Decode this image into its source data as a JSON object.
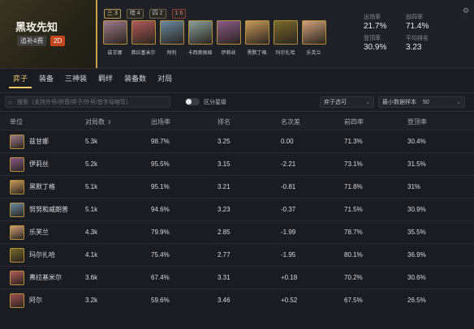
{
  "hero": {
    "title": "黑玫先知",
    "tier_tag": "追补4费",
    "cost_tag": "2D"
  },
  "traits": [
    {
      "label": "三 3",
      "style": "gold"
    },
    {
      "label": "暗 4",
      "style": ""
    },
    {
      "label": "四 2",
      "style": ""
    },
    {
      "label": "1 6",
      "style": "red"
    }
  ],
  "champions": [
    {
      "name": "兹甘娜",
      "color": "#9e7a8a"
    },
    {
      "name": "弗拉基米尔",
      "color": "#b05a58"
    },
    {
      "name": "阿利",
      "color": "#6a8aa0"
    },
    {
      "name": "卡西奥佩娅",
      "color": "#8aa09a"
    },
    {
      "name": "伊莉丝",
      "color": "#8a5a86"
    },
    {
      "name": "黑默丁格",
      "color": "#c89a5a"
    },
    {
      "name": "玛尔扎哈",
      "color": "#7a6a2a"
    },
    {
      "name": "乐芙兰",
      "color": "#d0a07a"
    }
  ],
  "stats": [
    {
      "label": "出场率",
      "value": "21.7%"
    },
    {
      "label": "前四率",
      "value": "71.4%"
    },
    {
      "label": "登顶率",
      "value": "30.9%"
    },
    {
      "label": "平均排名",
      "value": "3.23"
    }
  ],
  "tabs": [
    "弈子",
    "装备",
    "三神装",
    "羁绊",
    "装备数",
    "对局"
  ],
  "toolbar": {
    "search_placeholder": "搜索（支持外号/拼音/弈子/外号/首字母缩写）",
    "toggle_label": "区分星级",
    "select1": "弈子选可",
    "select2_label": "最小数据样本",
    "select2_value": "50"
  },
  "table": {
    "headers": [
      "单位",
      "对局数",
      "出场率",
      "排名",
      "名次差",
      "前四率",
      "登顶率"
    ],
    "rows": [
      {
        "name": "兹甘娜",
        "color": "#9e7a8a",
        "games": "5.3k",
        "pick": "98.7%",
        "rank": "3.25",
        "diff": "0.00",
        "top4": "71.3%",
        "win": "30.4%"
      },
      {
        "name": "伊莉丝",
        "color": "#8a5a86",
        "games": "5.2k",
        "pick": "95.5%",
        "rank": "3.15",
        "diff": "-2.21",
        "top4": "73.1%",
        "win": "31.5%"
      },
      {
        "name": "黑默丁格",
        "color": "#c89a5a",
        "games": "5.1k",
        "pick": "95.1%",
        "rank": "3.21",
        "diff": "-0.81",
        "top4": "71.8%",
        "win": "31%"
      },
      {
        "name": "努努和威朗普",
        "color": "#6a8aa0",
        "games": "5.1k",
        "pick": "94.6%",
        "rank": "3.23",
        "diff": "-0.37",
        "top4": "71.5%",
        "win": "30.9%"
      },
      {
        "name": "乐芙兰",
        "color": "#d0a07a",
        "games": "4.3k",
        "pick": "79.9%",
        "rank": "2.85",
        "diff": "-1.99",
        "top4": "78.7%",
        "win": "35.5%"
      },
      {
        "name": "玛尔扎哈",
        "color": "#7a6a2a",
        "games": "4.1k",
        "pick": "75.4%",
        "rank": "2.77",
        "diff": "-1.95",
        "top4": "80.1%",
        "win": "36.9%"
      },
      {
        "name": "弗拉基米尔",
        "color": "#b05a58",
        "games": "3.6k",
        "pick": "67.4%",
        "rank": "3.31",
        "diff": "+0.18",
        "top4": "70.2%",
        "win": "30.6%"
      },
      {
        "name": "阿尔",
        "color": "#a05050",
        "games": "3.2k",
        "pick": "59.6%",
        "rank": "3.46",
        "diff": "+0.52",
        "top4": "67.5%",
        "win": "26.5%"
      }
    ]
  }
}
